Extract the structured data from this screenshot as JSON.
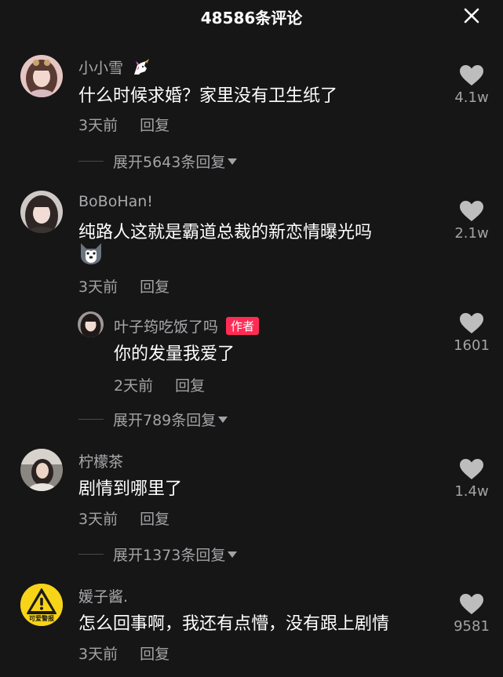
{
  "header": {
    "title": "48586条评论"
  },
  "comments": [
    {
      "username": "小小雪",
      "text": "什么时候求婚？家里没有卫生纸了",
      "time": "3天前",
      "reply_label": "回复",
      "likes": "4.1w",
      "expand_label": "展开5643条回复"
    },
    {
      "username": "BoBoHan!",
      "text": "纯路人这就是霸道总裁的新恋情曝光吗",
      "time": "3天前",
      "reply_label": "回复",
      "likes": "2.1w",
      "reply": {
        "username": "叶子筠吃饭了吗",
        "badge": "作者",
        "text": "你的发量我爱了",
        "time": "2天前",
        "reply_label": "回复",
        "likes": "1601"
      },
      "expand_label": "展开789条回复"
    },
    {
      "username": "柠檬茶",
      "text": "剧情到哪里了",
      "time": "3天前",
      "reply_label": "回复",
      "likes": "1.4w",
      "expand_label": "展开1373条回复"
    },
    {
      "username": "媛子酱.",
      "text": "怎么回事啊，我还有点懵，没有跟上剧情",
      "time": "3天前",
      "reply_label": "回复",
      "likes": "9581",
      "avatar_caption": "可爱警报"
    }
  ],
  "icons": {
    "close": "close-icon",
    "like": "heart-icon",
    "unicorn_emoji": "unicorn-emoji-icon",
    "husky_emoji": "husky-emoji-icon",
    "warning": "warning-icon"
  },
  "colors": {
    "background": "#161616",
    "username": "#a9a9ad",
    "meta": "#a3a3a7",
    "author_badge": "#fe2c55"
  }
}
